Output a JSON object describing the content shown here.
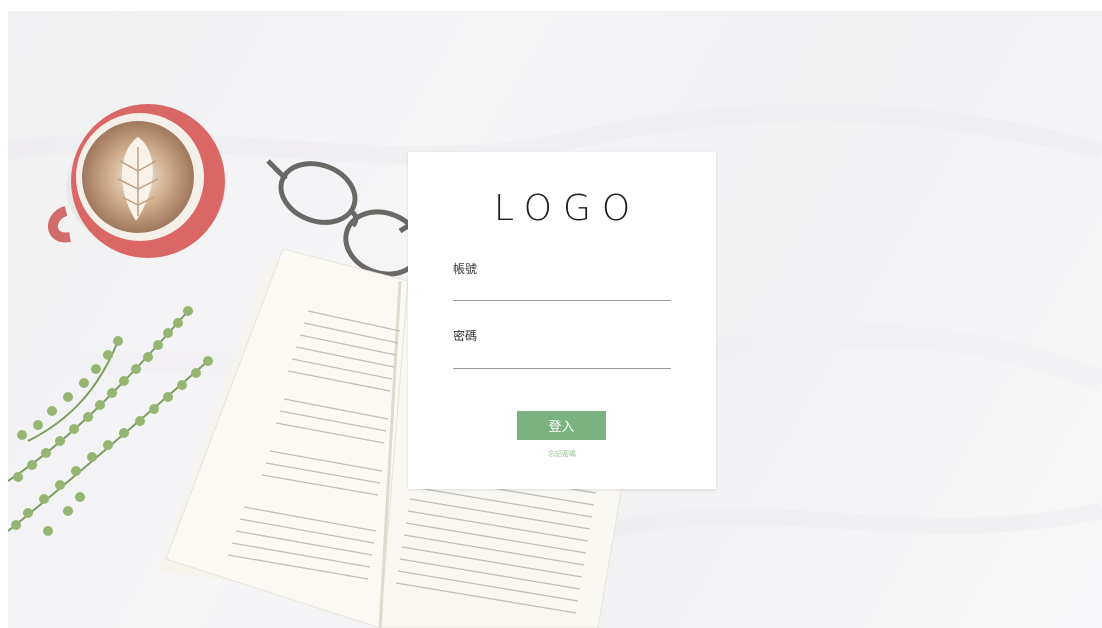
{
  "logo": {
    "text": "LOGO"
  },
  "form": {
    "account_label": "帳號",
    "account_value": "",
    "password_label": "密碼",
    "password_value": "",
    "login_button": "登入",
    "forgot_link": "忘記密碼"
  },
  "colors": {
    "accent": "#7bb380",
    "link": "#93bf96",
    "card": "#ffffff"
  },
  "background": {
    "icons": [
      "coffee-cup-icon",
      "glasses-icon",
      "open-book-icon",
      "plant-icon"
    ]
  }
}
